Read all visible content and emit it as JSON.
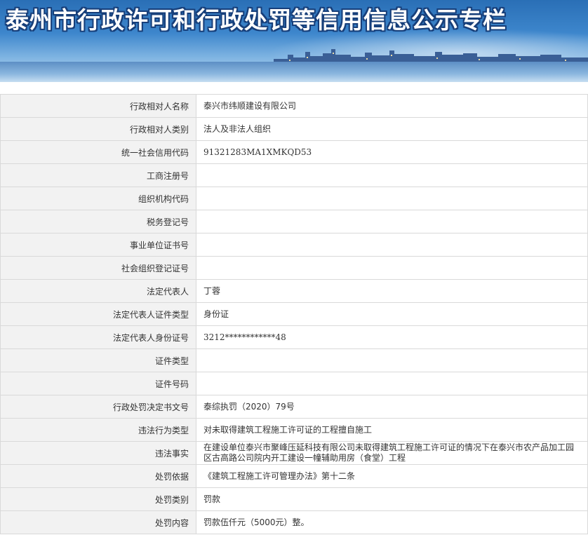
{
  "banner": {
    "title": "泰州市行政许可和行政处罚等信用信息公示专栏"
  },
  "rows": [
    {
      "label": "行政相对人名称",
      "value": "泰兴市纬顺建设有限公司"
    },
    {
      "label": "行政相对人类别",
      "value": "法人及非法人组织"
    },
    {
      "label": "统一社会信用代码",
      "value": "91321283MA1XMKQD53"
    },
    {
      "label": "工商注册号",
      "value": ""
    },
    {
      "label": "组织机构代码",
      "value": ""
    },
    {
      "label": "税务登记号",
      "value": ""
    },
    {
      "label": "事业单位证书号",
      "value": ""
    },
    {
      "label": "社会组织登记证号",
      "value": ""
    },
    {
      "label": "法定代表人",
      "value": "丁蓉"
    },
    {
      "label": "法定代表人证件类型",
      "value": "身份证"
    },
    {
      "label": "法定代表人身份证号",
      "value": "3212************48"
    },
    {
      "label": "证件类型",
      "value": ""
    },
    {
      "label": "证件号码",
      "value": ""
    },
    {
      "label": "行政处罚决定书文号",
      "value": "泰综执罚（2020）79号"
    },
    {
      "label": "违法行为类型",
      "value": "对未取得建筑工程施工许可证的工程擅自施工"
    },
    {
      "label": "违法事实",
      "value": "在建设单位泰兴市聚峰压延科技有限公司未取得建筑工程施工许可证的情况下在泰兴市农产品加工园区古高路公司院内开工建设一幢辅助用房（食堂）工程"
    },
    {
      "label": "处罚依据",
      "value": "《建筑工程施工许可管理办法》第十二条"
    },
    {
      "label": "处罚类别",
      "value": "罚款"
    },
    {
      "label": "处罚内容",
      "value": "罚款伍仟元（5000元）整。"
    }
  ]
}
